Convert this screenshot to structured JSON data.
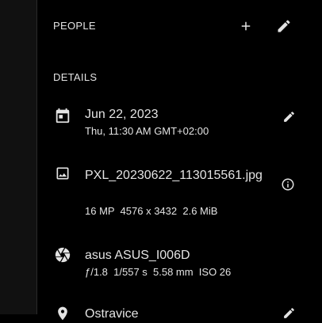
{
  "people": {
    "title": "PEOPLE",
    "add_icon": "plus-icon",
    "edit_icon": "pencil-icon"
  },
  "details": {
    "title": "DETAILS",
    "date": {
      "icon": "calendar-icon",
      "primary": "Jun 22, 2023",
      "secondary": "Thu, 11:30 AM GMT+02:00",
      "edit_icon": "pencil-icon"
    },
    "file": {
      "icon": "image-icon",
      "primary": "PXL_20230622_113015561.jpg",
      "secondary": "16 MP  4576 x 3432  2.6 MiB",
      "info_icon": "info-icon"
    },
    "camera": {
      "icon": "aperture-icon",
      "primary": "asus ASUS_I006D",
      "secondary": "ƒ/1.8  1/557 s  5.58 mm  ISO 26"
    },
    "location": {
      "icon": "location-pin-icon",
      "primary": "Ostravice",
      "edit_icon": "pencil-icon"
    }
  },
  "colors": {
    "background": "#000000",
    "text": "#e3e3e3",
    "icon": "#e3e3e3"
  }
}
